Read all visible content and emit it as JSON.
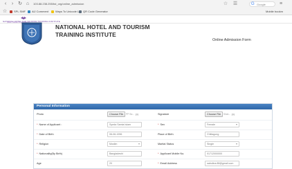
{
  "browser": {
    "url": "103.88.238.255/bd_org/online_admission",
    "search_placeholder": "Google",
    "bookmarks": [
      "SPL SMF",
      "AlJ Comment",
      "Ways To Unicode L",
      "QR Code Generator"
    ],
    "more_bookmarks_label": "Mobile bookm"
  },
  "logo": {
    "text": "NATIONAL HOTEL AND TOURISM TRAINING INSTITUTE",
    "sub": "(Govt. Tourism organization)"
  },
  "header": {
    "org_line1": "NATIONAL HOTEL AND TOURISM",
    "org_line2": "TRAINING INSTITUTE",
    "form_title": "Online Admission Form"
  },
  "panel": {
    "title": "Personal Information",
    "photo_label": "Photo",
    "photo_button": "Choose File",
    "photo_hint": "PP Siz... .jpg",
    "signature_label": "Signature",
    "signature_button": "Choose File",
    "signature_hint": "Shah... .jpg",
    "name_label": "Name of Applicant :",
    "name_value": "Syeda Samia Islam",
    "sex_label": "Sex",
    "sex_value": "Female",
    "dob_label": "Date of Birth",
    "dob_value": "06-06-1996",
    "pob_label": "Place of Birth",
    "pob_value": "Chittagong",
    "religion_label": "Religion",
    "religion_value": "Muslim",
    "marital_label": "Marital Status",
    "marital_value": "Single",
    "nationality_label": "Nationality(By Birth)",
    "nationality_value": "Bangladeshi",
    "mobile_label": "Applicant Mobile No.",
    "mobile_value": "01712000000",
    "age_label": "Age",
    "age_value": "20",
    "email_label": "Email Address",
    "email_value": "sabulina.88@gmail.com"
  }
}
